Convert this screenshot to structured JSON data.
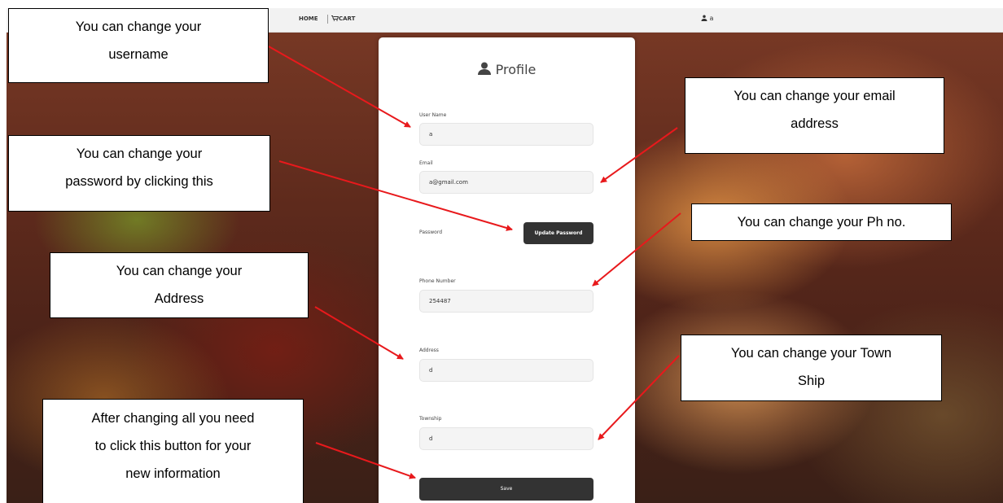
{
  "navbar": {
    "home_label": "HOME",
    "cart_label": "CART",
    "cart_icon": "cart-icon",
    "user_icon": "user-icon",
    "user_name": "a"
  },
  "profile": {
    "title": "Profile",
    "title_icon": "user-icon",
    "fields": {
      "username": {
        "label": "User Name",
        "value": "a"
      },
      "email": {
        "label": "Email",
        "value": "a@gmail.com"
      },
      "password": {
        "label": "Password",
        "button_label": "Update Password"
      },
      "phone": {
        "label": "Phone Number",
        "value": "254487"
      },
      "address": {
        "label": "Address",
        "value": "d"
      },
      "township": {
        "label": "Township",
        "value": "d"
      }
    },
    "save_label": "Save"
  },
  "annotations": {
    "username": [
      "You can change your",
      "username"
    ],
    "password": [
      "You can change your",
      "password by clicking this"
    ],
    "address": [
      "You can change your",
      "Address"
    ],
    "save": [
      "After changing all you need",
      "to click this button for your",
      "new information"
    ],
    "email": [
      "You can change your email",
      "address"
    ],
    "phone": [
      "You can change your Ph no."
    ],
    "township": [
      "You can change your Town",
      "Ship"
    ]
  },
  "colors": {
    "arrow": "#e8191c",
    "button": "#333333",
    "navbar": "#f2f2f2"
  }
}
